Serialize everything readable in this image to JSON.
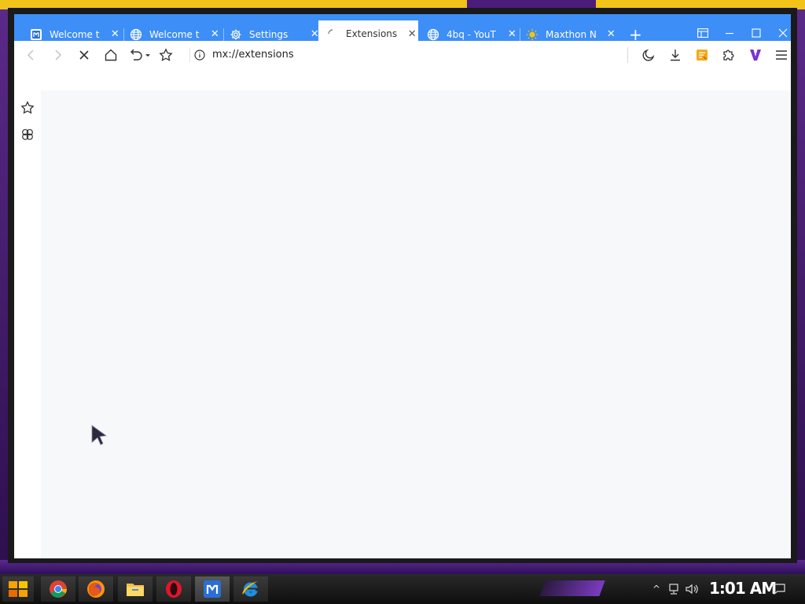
{
  "browser": {
    "tabs": [
      {
        "label": "Welcome t",
        "icon": "maxthon-logo-icon",
        "active": false
      },
      {
        "label": "Welcome t",
        "icon": "globe-icon",
        "active": false
      },
      {
        "label": "Settings",
        "icon": "gear-icon",
        "active": false
      },
      {
        "label": "Extensions",
        "icon": "loading-spinner-icon",
        "active": true
      },
      {
        "label": "4bq - YouT",
        "icon": "globe-icon",
        "active": false
      },
      {
        "label": "Maxthon N",
        "icon": "sun-icon",
        "active": false
      }
    ],
    "address": {
      "url": "mx://extensions",
      "info_icon": "info-icon"
    },
    "sidebar": [
      "star-icon",
      "hexagon-icon"
    ],
    "accent_color": "#3d8ef7"
  },
  "taskbar": {
    "clock": "1:01 AM",
    "apps": [
      "start-button",
      "chrome-icon",
      "firefox-icon",
      "file-explorer-icon",
      "opera-icon",
      "maxthon-icon",
      "internet-explorer-icon"
    ]
  }
}
